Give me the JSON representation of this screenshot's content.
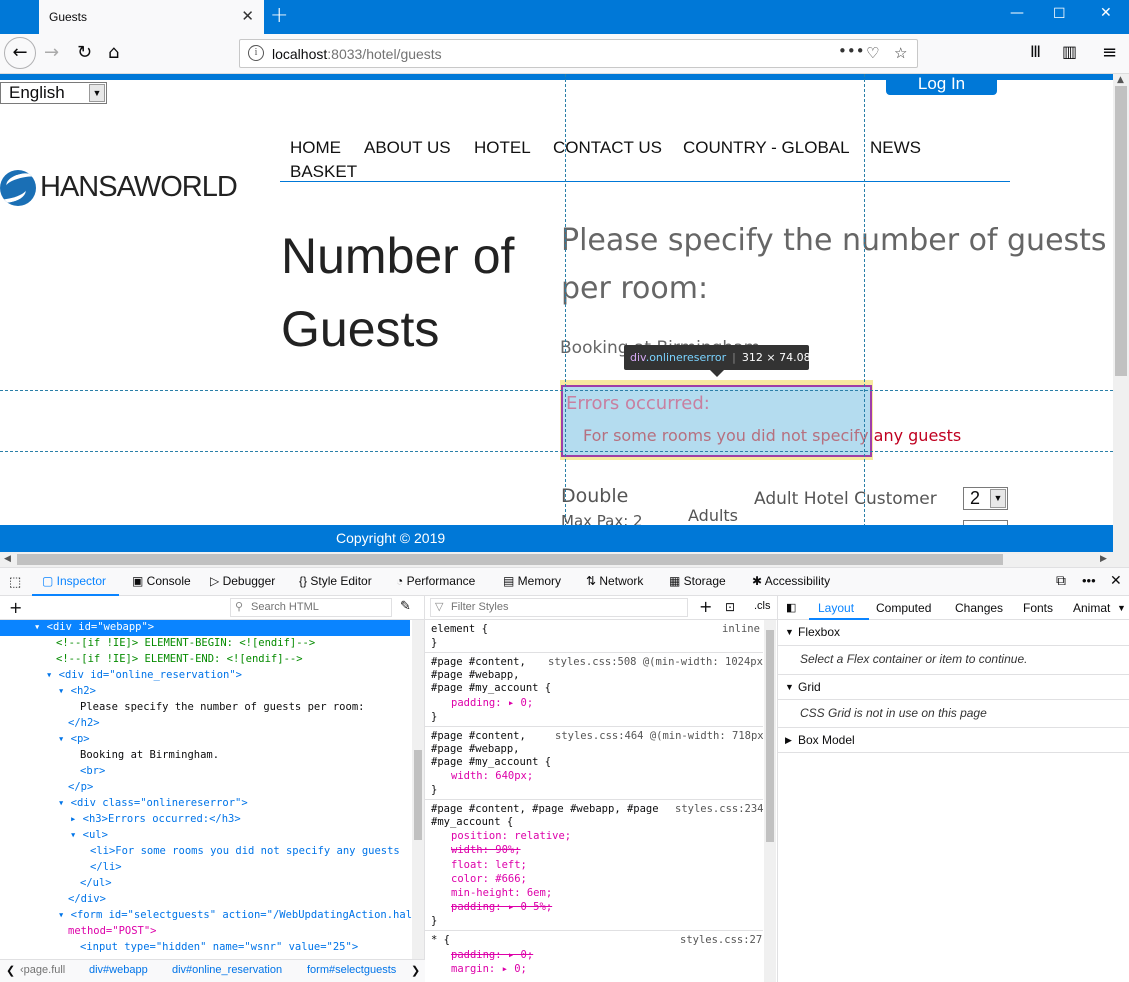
{
  "browser": {
    "tab_title": "Guests",
    "url_host": "localhost",
    "url_rest": ":8033/hotel/guests"
  },
  "page": {
    "language": "English",
    "login_label": "Log In",
    "logo_text": "HANSAWORLD",
    "nav": [
      "HOME",
      "ABOUT US",
      "HOTEL",
      "CONTACT US",
      "COUNTRY - GLOBAL",
      "NEWS",
      "BASKET"
    ],
    "heading": [
      "Number of",
      "Guests"
    ],
    "subheading": [
      "Please specify the number of guests",
      "per room:"
    ],
    "booking_text": "Booking at Birmingham.",
    "errors_title": "Errors occurred:",
    "error_item_a": "For some rooms you did not specify",
    "error_item_b": " any guests",
    "room_type": "Double",
    "max_pax": "Max Pax: 2",
    "adults_label": "Adults",
    "customer_label": "Adult Hotel Customer",
    "quantity": "2",
    "copyright": "Copyright © 2019"
  },
  "highlighter": {
    "tag": "div",
    "class": ".onlinereserror",
    "size": "312 × 74.0833"
  },
  "devtools": {
    "tabs": [
      "Inspector",
      "Console",
      "Debugger",
      "Style Editor",
      "Performance",
      "Memory",
      "Network",
      "Storage",
      "Accessibility"
    ],
    "search_html": "Search HTML",
    "filter_styles": "Filter Styles",
    "cls": ".cls",
    "layout_tabs": [
      "Layout",
      "Computed",
      "Changes",
      "Fonts",
      "Animat"
    ],
    "flexbox": "Flexbox",
    "flexbox_msg": "Select a Flex container or item to continue.",
    "grid": "Grid",
    "grid_msg": "CSS Grid is not in use on this page",
    "box_model": "Box Model",
    "breadcrumbs": [
      "‹page.full",
      "div#webapp",
      "div#online_reservation",
      "form#selectguests"
    ],
    "html_lines": {
      "l0": "<div id=\"webapp\">",
      "l1": "<!--[if !IE]> ELEMENT-BEGIN: <![endif]-->",
      "l2": "<!--[if !IE]> ELEMENT-END: <![endif]-->",
      "l3": "<div id=\"online_reservation\">",
      "l4": "<h2>",
      "l5": "Please specify the number of guests per room:",
      "l6": "</h2>",
      "l7": "<p>",
      "l8": "Booking at Birmingham.",
      "l9": "<br>",
      "l10": "</p>",
      "l11": "<div class=\"onlinereserror\">",
      "l12": "<h3>Errors occurred:</h3>",
      "l13": "<ul>",
      "l14": "<li>For some rooms you did not specify any guests",
      "l15": "</li>",
      "l16": "</ul>",
      "l17": "</div>",
      "l18": "<form id=\"selectguests\" action=\"/WebUpdatingAction.hal\"",
      "l19": "method=\"POST\">",
      "l20": "<input type=\"hidden\" name=\"wsnr\" value=\"25\">"
    },
    "css": {
      "r0_sel": "element {",
      "r0_src": "inline",
      "r1_sel": [
        "#page #content,",
        "#page #webapp,",
        "#page #my_account {"
      ],
      "r1_src": "styles.css:508 @(min-width: 1024px)",
      "r1_prop": "padding: ▸ 0;",
      "r2_sel": [
        "#page #content,",
        "#page #webapp,",
        "#page #my_account {"
      ],
      "r2_src": "styles.css:464 @(min-width: 718px)",
      "r2_prop": "width: 640px;",
      "r3_sel": [
        "#page #content, #page #webapp, #page",
        "#my_account {"
      ],
      "r3_src": "styles.css:234",
      "r3_props": [
        "position: relative;",
        "width: 90%;",
        "float: left;",
        "color: #666;",
        "min-height: 6em;",
        "padding: ▸ 0 5%;"
      ],
      "r4_sel": "* {",
      "r4_src": "styles.css:27",
      "r4_props": [
        "padding: ▸ 0;",
        "margin: ▸ 0;"
      ]
    }
  }
}
